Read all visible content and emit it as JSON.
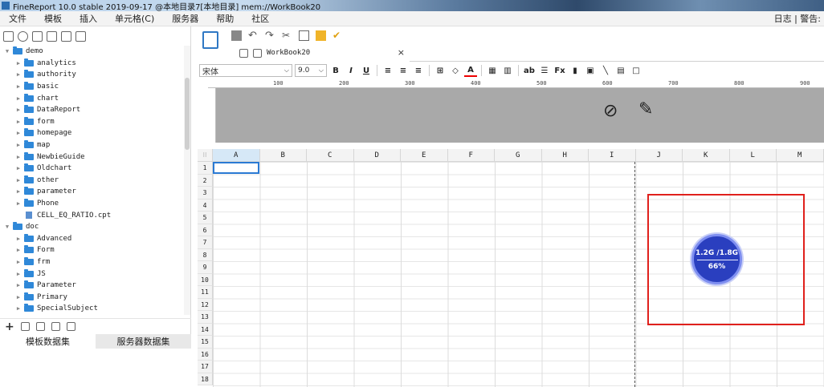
{
  "titlebar": {
    "title": "FineReport 10.0 stable 2019-09-17 @本地目录7[本地目录]    mem://WorkBook20"
  },
  "menu": {
    "items": [
      "文件",
      "模板",
      "插入",
      "单元格(C)",
      "服务器",
      "帮助",
      "社区"
    ],
    "right": "日志 | 警告:"
  },
  "tree": {
    "rows": [
      {
        "label": "demo",
        "level": 0,
        "expanded": true
      },
      {
        "label": "analytics",
        "level": 1
      },
      {
        "label": "authority",
        "level": 1
      },
      {
        "label": "basic",
        "level": 1
      },
      {
        "label": "chart",
        "level": 1
      },
      {
        "label": "DataReport",
        "level": 1
      },
      {
        "label": "form",
        "level": 1
      },
      {
        "label": "homepage",
        "level": 1
      },
      {
        "label": "map",
        "level": 1
      },
      {
        "label": "NewbieGuide",
        "level": 1
      },
      {
        "label": "Oldchart",
        "level": 1
      },
      {
        "label": "other",
        "level": 1
      },
      {
        "label": "parameter",
        "level": 1
      },
      {
        "label": "Phone",
        "level": 1
      },
      {
        "label": "CELL_EQ_RATIO.cpt",
        "level": 1,
        "file": true
      },
      {
        "label": "doc",
        "level": 0,
        "expanded": true
      },
      {
        "label": "Advanced",
        "level": 1
      },
      {
        "label": "Form",
        "level": 1
      },
      {
        "label": "frm",
        "level": 1
      },
      {
        "label": "JS",
        "level": 1
      },
      {
        "label": "Parameter",
        "level": 1
      },
      {
        "label": "Primary",
        "level": 1
      },
      {
        "label": "SpecialSubject",
        "level": 1
      }
    ]
  },
  "datasets": {
    "template_tab": "模板数据集",
    "server_tab": "服务器数据集"
  },
  "doc_tab": {
    "label": "WorkBook20",
    "close": "×"
  },
  "format": {
    "font": "宋体",
    "size": "9.0",
    "bold": "B",
    "italic": "I",
    "underline": "U"
  },
  "ruler": [
    "100",
    "200",
    "300",
    "400",
    "500",
    "600",
    "700",
    "800",
    "900"
  ],
  "columns": [
    "A",
    "B",
    "C",
    "D",
    "E",
    "F",
    "G",
    "H",
    "I",
    "J",
    "K",
    "L",
    "M"
  ],
  "rows": [
    "1",
    "2",
    "3",
    "4",
    "5",
    "6",
    "7",
    "8",
    "9",
    "10",
    "11",
    "12",
    "13",
    "14",
    "15",
    "16",
    "17",
    "18"
  ],
  "memory": {
    "usage": "1.2G /1.8G",
    "percent": "66%",
    "fraction": 0.66,
    "color": "#2a3fbf"
  },
  "colors": {
    "highlight_box": "#e0201c",
    "accent": "#2a7ad4"
  }
}
